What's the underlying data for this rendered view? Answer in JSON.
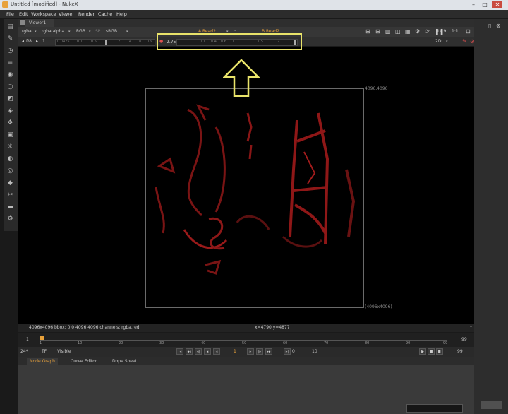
{
  "window": {
    "title": "Untitled [modified] - NukeX"
  },
  "menu": [
    "File",
    "Edit",
    "Workspace",
    "Viewer",
    "Render",
    "Cache",
    "Help"
  ],
  "viewer_tab": {
    "label": "Viewer1"
  },
  "controls": {
    "channels": "rgba",
    "layer": "rgba.alpha",
    "display": "RGB",
    "sp_label": "SP",
    "colorspace": "sRGB",
    "input_a": "A  Read2",
    "input_b": "B  Read2",
    "zoom": "14.9",
    "ratio": "1:1",
    "f_stop_label": "f/8",
    "gain_value": "1",
    "gamma_value": "2.75",
    "view_mode": "2D",
    "gain_ticks": [
      "0.0425",
      "0.1",
      "0.5",
      "1",
      "2",
      "4",
      "8",
      "16"
    ],
    "gamma_ticks": [
      "0.1",
      "0.4",
      "0.6",
      "1",
      "1.5",
      "2"
    ]
  },
  "viewer": {
    "format_tr": "4096,4096",
    "format_br": "(4096x4096)",
    "info_left": "4096x4096   bbox: 0 0 4096 4096 channels: rgba.red",
    "info_coords": "x=4790 y=4877"
  },
  "timeline": {
    "start": "1",
    "end": "99",
    "ticks": [
      "1",
      "10",
      "20",
      "30",
      "40",
      "50",
      "60",
      "70",
      "80",
      "90",
      "99"
    ],
    "fps": "24*",
    "tf": "TF",
    "visible": "Visible",
    "current_frame": "1",
    "step_a": "0",
    "step_b": "10",
    "end_frame": "99"
  },
  "bottom_tabs": [
    "Node Graph",
    "Curve Editor",
    "Dope Sheet"
  ],
  "colors": {
    "highlight": "#e9e36a",
    "accent": "#e8a13a",
    "red_channel": "#c41f1f"
  }
}
